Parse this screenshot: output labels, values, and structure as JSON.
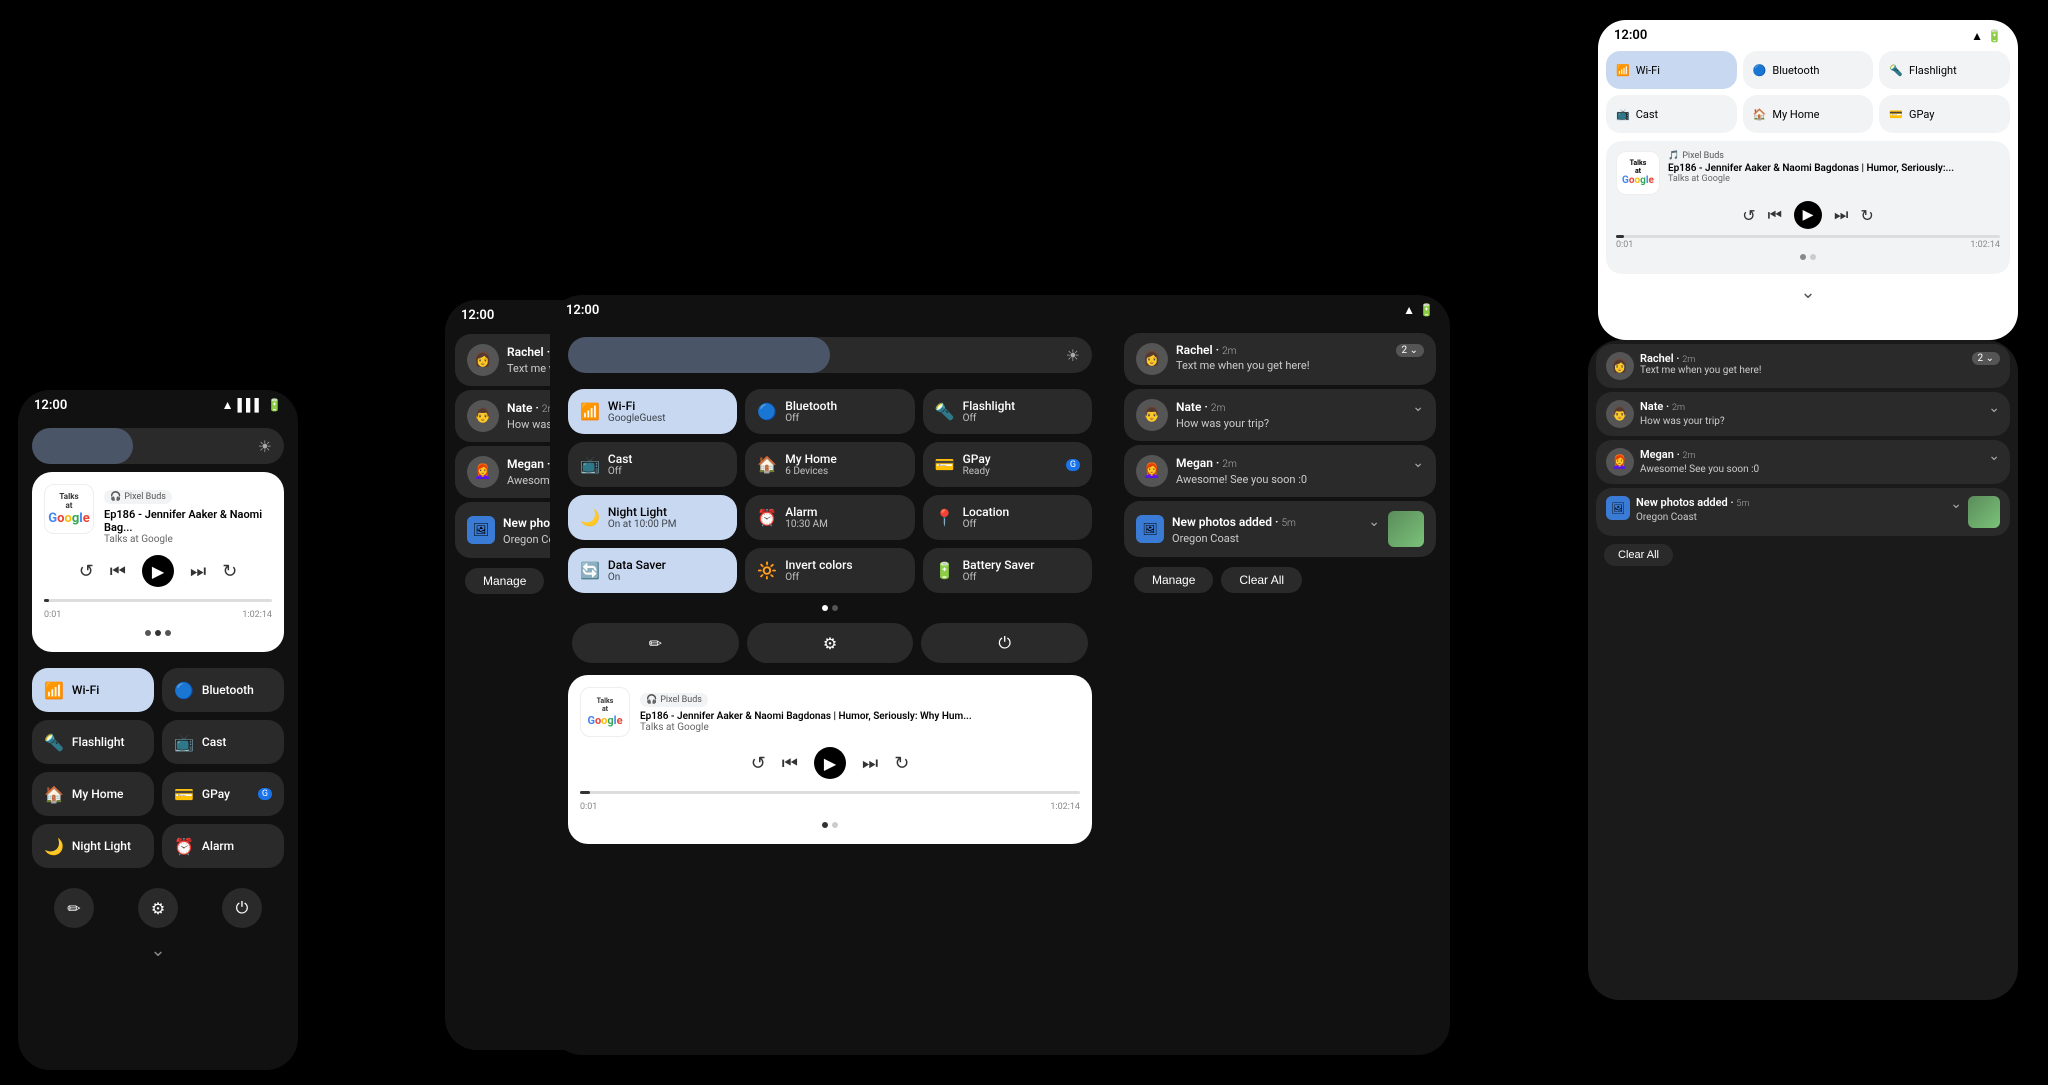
{
  "devices": {
    "phone_small": {
      "status_time": "12:00",
      "brightness": 40,
      "media": {
        "show": "Talks at Google",
        "title": "Ep186 - Jennifer Aaker & Naomi Bag...",
        "subtitle": "Talks at Google",
        "source": "Pixel Buds",
        "time_current": "0:01",
        "time_total": "1:02:14"
      },
      "tiles": [
        {
          "label": "Wi-Fi",
          "sub": "",
          "active": true,
          "icon": "📶"
        },
        {
          "label": "Bluetooth",
          "sub": "",
          "active": false,
          "icon": "🔵"
        },
        {
          "label": "Flashlight",
          "sub": "",
          "active": false,
          "icon": "🔦"
        },
        {
          "label": "Cast",
          "sub": "",
          "active": false,
          "icon": "📺"
        },
        {
          "label": "My Home",
          "sub": "",
          "active": false,
          "icon": "🏠"
        },
        {
          "label": "GPay",
          "sub": "",
          "active": false,
          "icon": "💳"
        },
        {
          "label": "Night Light",
          "sub": "",
          "active": false,
          "icon": "🌙"
        },
        {
          "label": "Alarm",
          "sub": "",
          "active": false,
          "icon": "⏰"
        }
      ],
      "actions": [
        "✏️",
        "⚙️",
        "⏻"
      ]
    },
    "tablet_mid": {
      "status_time": "12:00",
      "tiles": [
        {
          "label": "Wi-Fi",
          "sub": "GoogleGuest",
          "active": true,
          "icon": "wifi"
        },
        {
          "label": "Bluetooth",
          "sub": "Off",
          "active": false,
          "icon": "bluetooth"
        },
        {
          "label": "Flashlight",
          "sub": "Off",
          "active": false,
          "icon": "flashlight"
        },
        {
          "label": "Cast",
          "sub": "Off",
          "active": false,
          "icon": "cast"
        },
        {
          "label": "My Home",
          "sub": "6 Devices",
          "active": false,
          "icon": "home"
        },
        {
          "label": "GPay",
          "sub": "Ready",
          "active": false,
          "icon": "gpay"
        },
        {
          "label": "Night Light",
          "sub": "On at 10:00 PM",
          "active": true,
          "icon": "moon"
        },
        {
          "label": "Alarm",
          "sub": "10:30 AM",
          "active": false,
          "icon": "alarm"
        },
        {
          "label": "Location",
          "sub": "Off",
          "active": false,
          "icon": "location"
        },
        {
          "label": "Data Saver",
          "sub": "On",
          "active": true,
          "icon": "data"
        },
        {
          "label": "Invert colors",
          "sub": "Off",
          "active": false,
          "icon": "invert"
        },
        {
          "label": "Battery Saver",
          "sub": "Off",
          "active": false,
          "icon": "battery"
        }
      ],
      "media": {
        "show": "Talks at Google",
        "title": "Ep186 - Jennifer Aaker & Naomi Bagdonas | Humor, Seriously: Why Hum...",
        "subtitle": "Talks at Google",
        "source": "Pixel Buds",
        "time_current": "0:01",
        "time_total": "1:02:14"
      }
    },
    "tablet_large": {
      "status_time": "12:00",
      "notifications": [
        {
          "name": "Rachel",
          "time": "2m",
          "msg": "Text me when you get here!",
          "badge": "2",
          "avatar": "👩"
        },
        {
          "name": "Nate",
          "time": "2m",
          "msg": "How was your trip?",
          "avatar": "👨"
        },
        {
          "name": "Megan",
          "time": "2m",
          "msg": "Awesome! See you soon :0",
          "avatar": "👩‍🦰"
        },
        {
          "name": "New photos added",
          "time": "5m",
          "msg": "Oregon Coast",
          "avatar": "🏔️",
          "is_photo": true
        }
      ],
      "notif_actions": {
        "manage": "Manage",
        "clear_all": "Clear All"
      }
    },
    "phone_right": {
      "status_time": "12:00",
      "tiles": [
        {
          "label": "Wi-Fi",
          "sub": "",
          "active": true,
          "icon": "wifi"
        },
        {
          "label": "Bluetooth",
          "sub": "",
          "active": false,
          "icon": "bluetooth"
        },
        {
          "label": "Flashlight",
          "sub": "",
          "active": false,
          "icon": "flashlight"
        },
        {
          "label": "Cast",
          "sub": "",
          "active": false,
          "icon": "cast"
        },
        {
          "label": "My Home",
          "sub": "",
          "active": false,
          "icon": "home"
        },
        {
          "label": "GPay",
          "sub": "",
          "active": false,
          "icon": "gpay"
        }
      ],
      "media": {
        "show": "Talks at Google",
        "title": "Ep186 - Jennifer Aaker & Naomi Bagdonas | Humor, Seriously:...",
        "subtitle": "Talks at Google",
        "source": "Pixel Buds",
        "time_current": "0:01",
        "time_total": "1:02:14"
      }
    },
    "panel_right": {
      "notifications": [
        {
          "name": "Rachel",
          "time": "2m",
          "msg": "Text me when you get here!",
          "badge": "2",
          "avatar": "👩"
        },
        {
          "name": "Nate",
          "time": "2m",
          "msg": "How was your trip?",
          "avatar": "👨"
        },
        {
          "name": "Megan",
          "time": "2m",
          "msg": "Awesome! See you soon :0",
          "avatar": "👩‍🦰"
        },
        {
          "name": "New photos added",
          "time": "5m",
          "msg": "Oregon Coast",
          "avatar": "🏔️",
          "is_photo": true
        }
      ],
      "notif_actions": {
        "clear_all": "Clear All"
      }
    }
  }
}
